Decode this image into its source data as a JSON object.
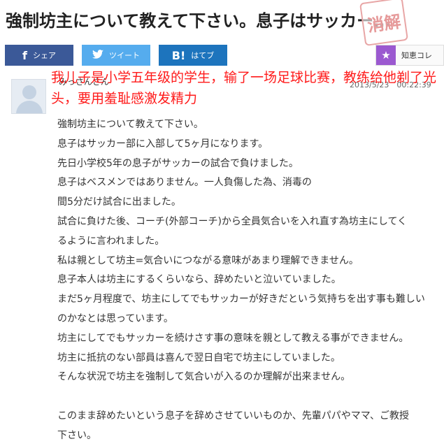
{
  "question_title": "強制坊主について教えて下さい。息子はサッカー…",
  "stamp_text": "消解",
  "share": {
    "facebook_label": "シェア",
    "twitter_label": "ツイート",
    "hatena_icon": "B!",
    "hatena_label": "はてブ",
    "chiekore_label": "知恵コレ"
  },
  "asker": {
    "name": "みっさんさん",
    "timestamp": "2013/5/23　00:22:39"
  },
  "annotation": "我儿子是小学五年级的学生，输了一场足球比赛，教练给他剃了光头，要用羞耻感激发精力",
  "body_lines": [
    "強制坊主について教えて下さい。",
    "息子はサッカー部に入部して5ヶ月になります。",
    "先日小学校5年の息子がサッカーの試合で負けました。",
    "息子はベスメンではありません。一人負傷した為、消毒の",
    "間5分だけ試合に出ました。",
    "試合に負けた後、コーチ(外部コーチ)から全員気合いを入れ直す為坊主にしてく",
    "るように言われました。",
    "私は親として坊主=気合いにつながる意味があまり理解できません。",
    "息子本人は坊主にするくらいなら、辞めたいと泣いていました。",
    "まだ5ヶ月程度で、坊主にしてでもサッカーが好きだという気持ちを出す事も難しい",
    "のかなとは思っています。",
    "坊主にしてでもサッカーを続けさす事の意味を親として教える事ができません。",
    "坊主に抵抗のない部員は喜んで翌日自宅で坊主にしていました。",
    "そんな状況で坊主を強制して気合いが入るのか理解が出来ません。"
  ],
  "body_closing": [
    "このまま辞めたいという息子を辞めさせていいものか、先輩パパやママ、ご教授",
    "下さい。"
  ]
}
